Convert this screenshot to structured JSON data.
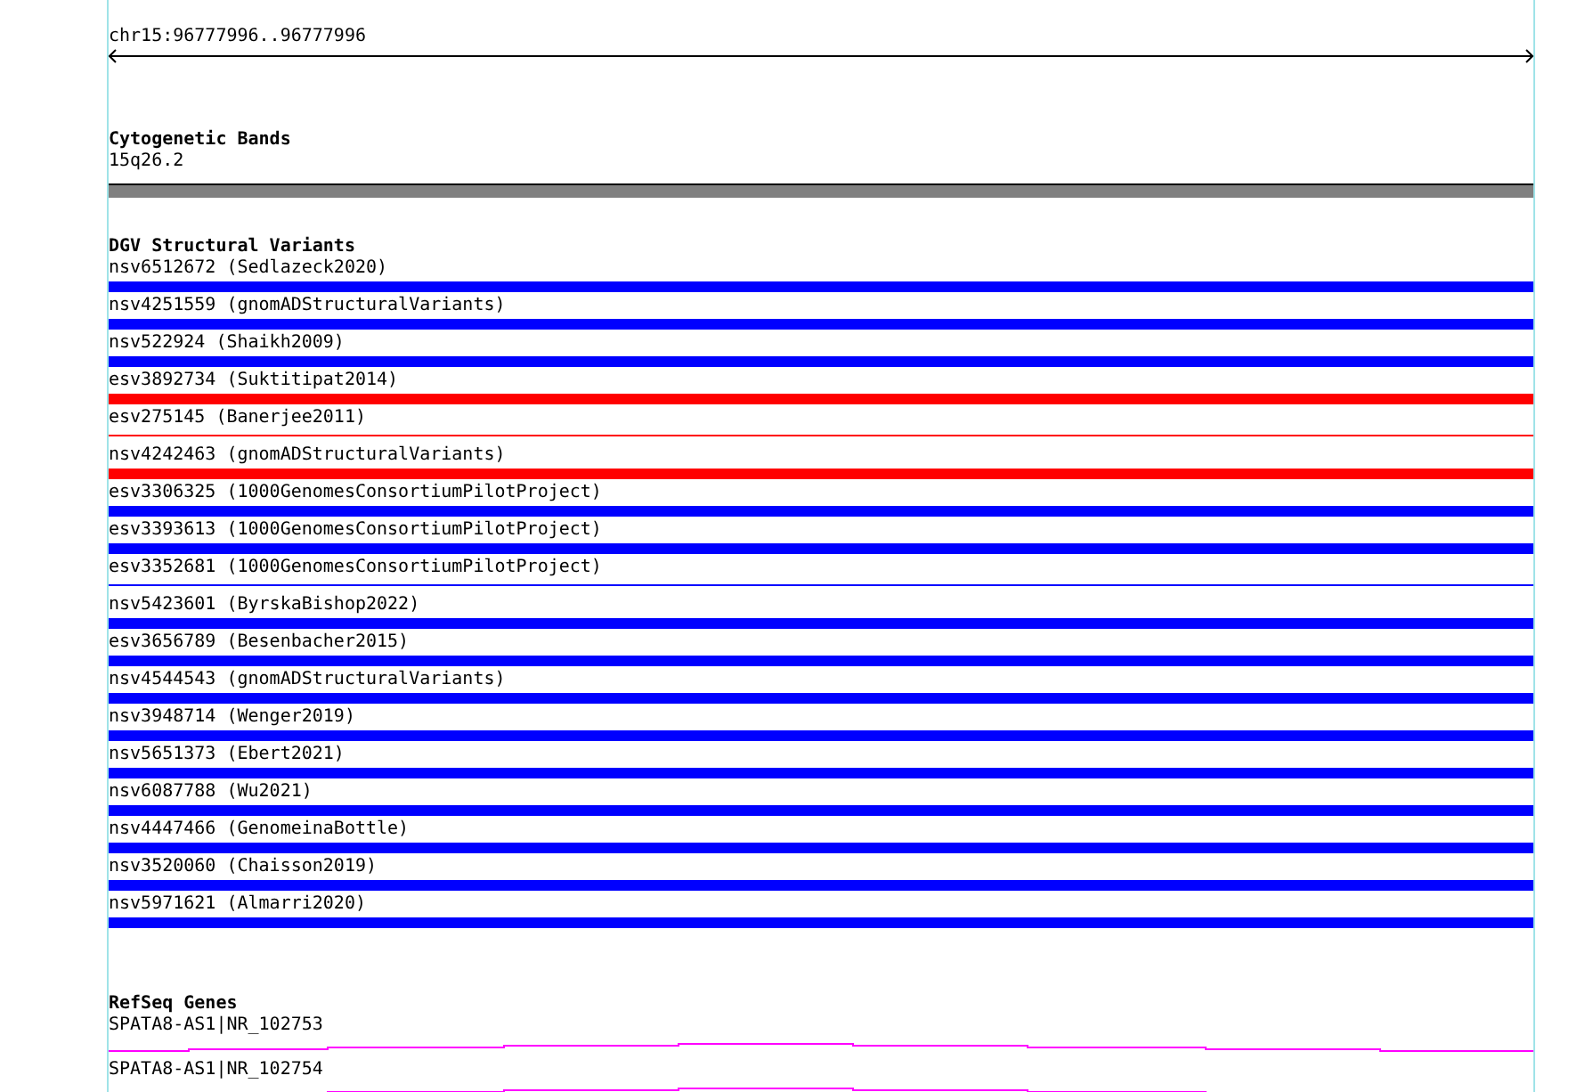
{
  "ruler": {
    "label": "chr15:96777996..96777996"
  },
  "tracks": [
    {
      "kind": "bands",
      "title": "Cytogenetic Bands",
      "features": [
        {
          "label": "15q26.2"
        }
      ]
    },
    {
      "kind": "variants",
      "title": "DGV Structural Variants",
      "features": [
        {
          "label": "nsv6512672 (Sedlazeck2020)",
          "color": "#0000ff",
          "kind": "thick"
        },
        {
          "label": "nsv4251559 (gnomADStructuralVariants)",
          "color": "#0000ff",
          "kind": "thick"
        },
        {
          "label": "nsv522924 (Shaikh2009)",
          "color": "#0000ff",
          "kind": "thick"
        },
        {
          "label": "esv3892734 (Suktitipat2014)",
          "color": "#ff0000",
          "kind": "thick"
        },
        {
          "label": "esv275145 (Banerjee2011)",
          "color": "#ff0000",
          "kind": "thin"
        },
        {
          "label": "nsv4242463 (gnomADStructuralVariants)",
          "color": "#ff0000",
          "kind": "thick"
        },
        {
          "label": "esv3306325 (1000GenomesConsortiumPilotProject)",
          "color": "#0000ff",
          "kind": "thick"
        },
        {
          "label": "esv3393613 (1000GenomesConsortiumPilotProject)",
          "color": "#0000ff",
          "kind": "thick"
        },
        {
          "label": "esv3352681 (1000GenomesConsortiumPilotProject)",
          "color": "#0000ff",
          "kind": "thin"
        },
        {
          "label": "nsv5423601 (ByrskaBishop2022)",
          "color": "#0000ff",
          "kind": "thick"
        },
        {
          "label": "esv3656789 (Besenbacher2015)",
          "color": "#0000ff",
          "kind": "thick"
        },
        {
          "label": "nsv4544543 (gnomADStructuralVariants)",
          "color": "#0000ff",
          "kind": "thick"
        },
        {
          "label": "nsv3948714 (Wenger2019)",
          "color": "#0000ff",
          "kind": "thick"
        },
        {
          "label": "nsv5651373 (Ebert2021)",
          "color": "#0000ff",
          "kind": "thick"
        },
        {
          "label": "nsv6087788 (Wu2021)",
          "color": "#0000ff",
          "kind": "thick"
        },
        {
          "label": "nsv4447466 (GenomeinaBottle)",
          "color": "#0000ff",
          "kind": "thick"
        },
        {
          "label": "nsv3520060 (Chaisson2019)",
          "color": "#0000ff",
          "kind": "thick"
        },
        {
          "label": "nsv5971621 (Almarri2020)",
          "color": "#0000ff",
          "kind": "thick"
        }
      ]
    },
    {
      "kind": "genes",
      "title": "RefSeq Genes",
      "features": [
        {
          "label": "SPATA8-AS1|NR_102753"
        },
        {
          "label": "SPATA8-AS1|NR_102754"
        }
      ]
    }
  ]
}
